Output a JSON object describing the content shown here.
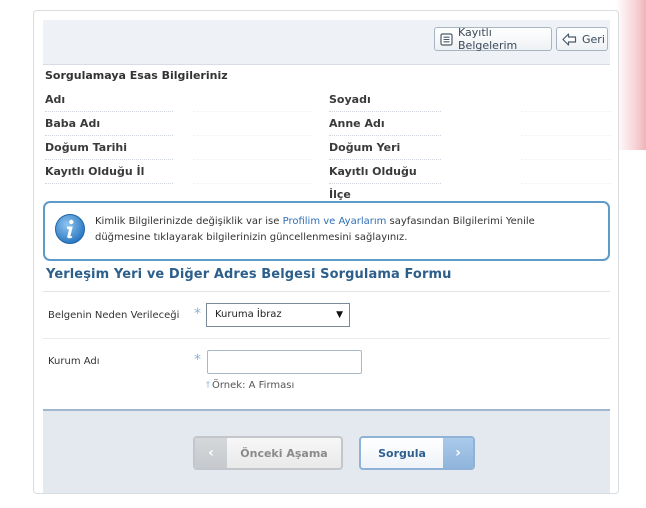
{
  "toolbar": {
    "records_label": "Kayıtlı Belgelerim",
    "back_label": "Geri"
  },
  "info": {
    "title": "Sorgulamaya Esas Bilgileriniz",
    "rows": [
      {
        "left_label": "Adı",
        "left_value": "",
        "right_label": "Soyadı",
        "right_value": ""
      },
      {
        "left_label": "Baba Adı",
        "left_value": "",
        "right_label": "Anne Adı",
        "right_value": ""
      },
      {
        "left_label": "Doğum Tarihi",
        "left_value": "",
        "right_label": "Doğum Yeri",
        "right_value": ""
      },
      {
        "left_label": "Kayıtlı Olduğu İl",
        "left_value": "",
        "right_label": "Kayıtlı Olduğu İlçe",
        "right_value": ""
      }
    ]
  },
  "notice": {
    "text_before": "Kimlik Bilgilerinizde değişiklik var ise ",
    "link_text": "Profilim ve Ayarlarım",
    "text_after": " sayfasından Bilgilerimi Yenile düğmesine tıklayarak bilgilerinizin güncellenmesini sağlayınız."
  },
  "form": {
    "title": "Yerleşim Yeri ve Diğer Adres Belgesi Sorgulama Formu",
    "reason_label": "Belgenin Neden Verileceği",
    "reason_selected": "Kuruma İbraz",
    "institution_label": "Kurum Adı",
    "institution_value": "",
    "required_mark": "*",
    "hint_mark": "†",
    "institution_hint": "Örnek: A Firması"
  },
  "footer": {
    "prev_label": "Önceki Aşama",
    "query_label": "Sorgula"
  },
  "colors": {
    "accent": "#2c5f8c",
    "link": "#2f6fb7",
    "notice_border": "#5e9bc8",
    "footer_bg": "#e4e9ef"
  },
  "icons": {
    "records": "document-list-icon",
    "back": "back-arrow-icon",
    "notice": "info-icon",
    "prev": "chevron-left-icon",
    "query": "chevron-right-icon"
  }
}
